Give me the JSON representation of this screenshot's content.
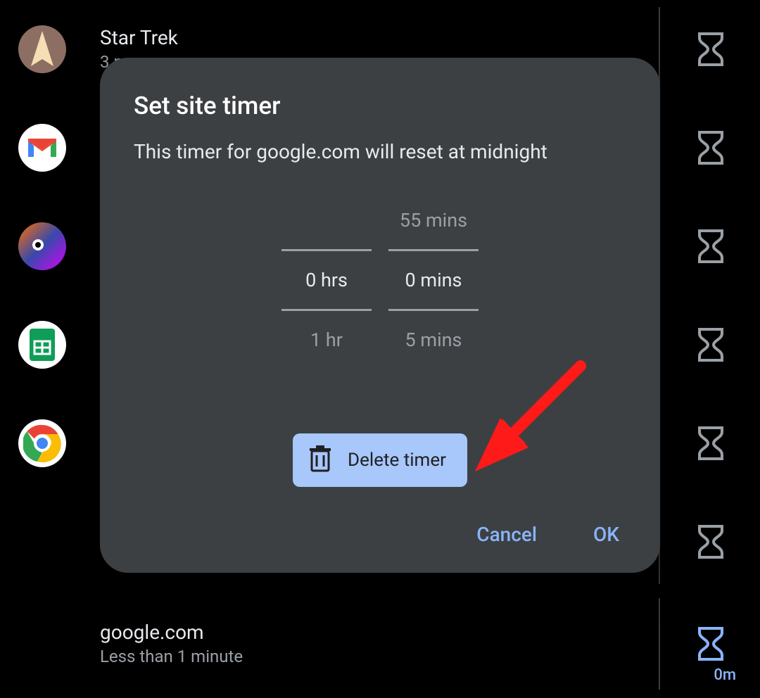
{
  "colors": {
    "dialog_bg": "#3c4043",
    "accent": "#8ab4f8",
    "delete_bg": "#a8c7fa",
    "arrow": "#ff1a1a"
  },
  "bg_items": [
    {
      "title": "Star Trek",
      "sub": "3 m",
      "icon": "star-trek",
      "icon_bg": "#8d6e63"
    },
    {
      "title": "",
      "sub": "",
      "icon": "gmail",
      "icon_bg": "#ffffff"
    },
    {
      "title": "",
      "sub": "",
      "icon": "rocket",
      "icon_bg": "#3949ab"
    },
    {
      "title": "",
      "sub": "",
      "icon": "sheets",
      "icon_bg": "#ffffff"
    },
    {
      "title": "",
      "sub": "",
      "icon": "chrome",
      "icon_bg": "#ffffff"
    }
  ],
  "chrome_item": {
    "title": "google.com",
    "sub": "Less than 1 minute",
    "usage_label": "0m"
  },
  "dialog": {
    "title": "Set site timer",
    "subtitle": "This timer for google.com will reset at midnight",
    "picker": {
      "hours": {
        "above": "",
        "selected": "0 hrs",
        "below": "1 hr"
      },
      "minutes": {
        "above": "55 mins",
        "selected": "0 mins",
        "below": "5 mins"
      }
    },
    "delete_label": "Delete timer",
    "cancel_label": "Cancel",
    "ok_label": "OK"
  }
}
